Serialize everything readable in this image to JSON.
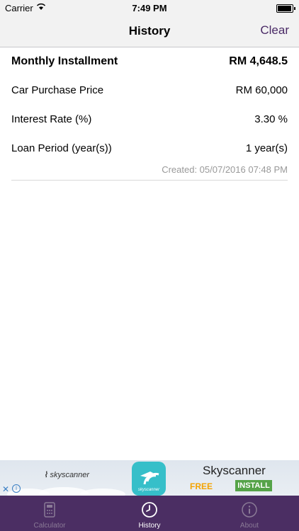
{
  "status_bar": {
    "carrier": "Carrier",
    "time": "7:49 PM"
  },
  "nav": {
    "title": "History",
    "clear_label": "Clear"
  },
  "history": {
    "monthly_installment": {
      "label": "Monthly Installment",
      "value": "RM 4,648.5"
    },
    "car_price": {
      "label": "Car Purchase Price",
      "value": "RM 60,000"
    },
    "interest_rate": {
      "label": "Interest Rate (%)",
      "value": "3.30 %"
    },
    "loan_period": {
      "label": "Loan Period (year(s))",
      "value": "1 year(s)"
    },
    "created": "Created: 05/07/2016 07:48 PM"
  },
  "ad": {
    "logo_text": "skyscanner",
    "icon_text": "skyscanner",
    "app_name": "Skyscanner",
    "price": "FREE",
    "install_label": "INSTALL"
  },
  "tabs": [
    {
      "label": "Calculator",
      "icon": "calculator-icon",
      "active": false
    },
    {
      "label": "History",
      "icon": "clock-icon",
      "active": true
    },
    {
      "label": "About",
      "icon": "info-icon",
      "active": false
    }
  ],
  "colors": {
    "nav_accent": "#4a2a66",
    "tab_bar": "#4b2e63",
    "install_button": "#55a348",
    "free_text": "#f4a300"
  }
}
